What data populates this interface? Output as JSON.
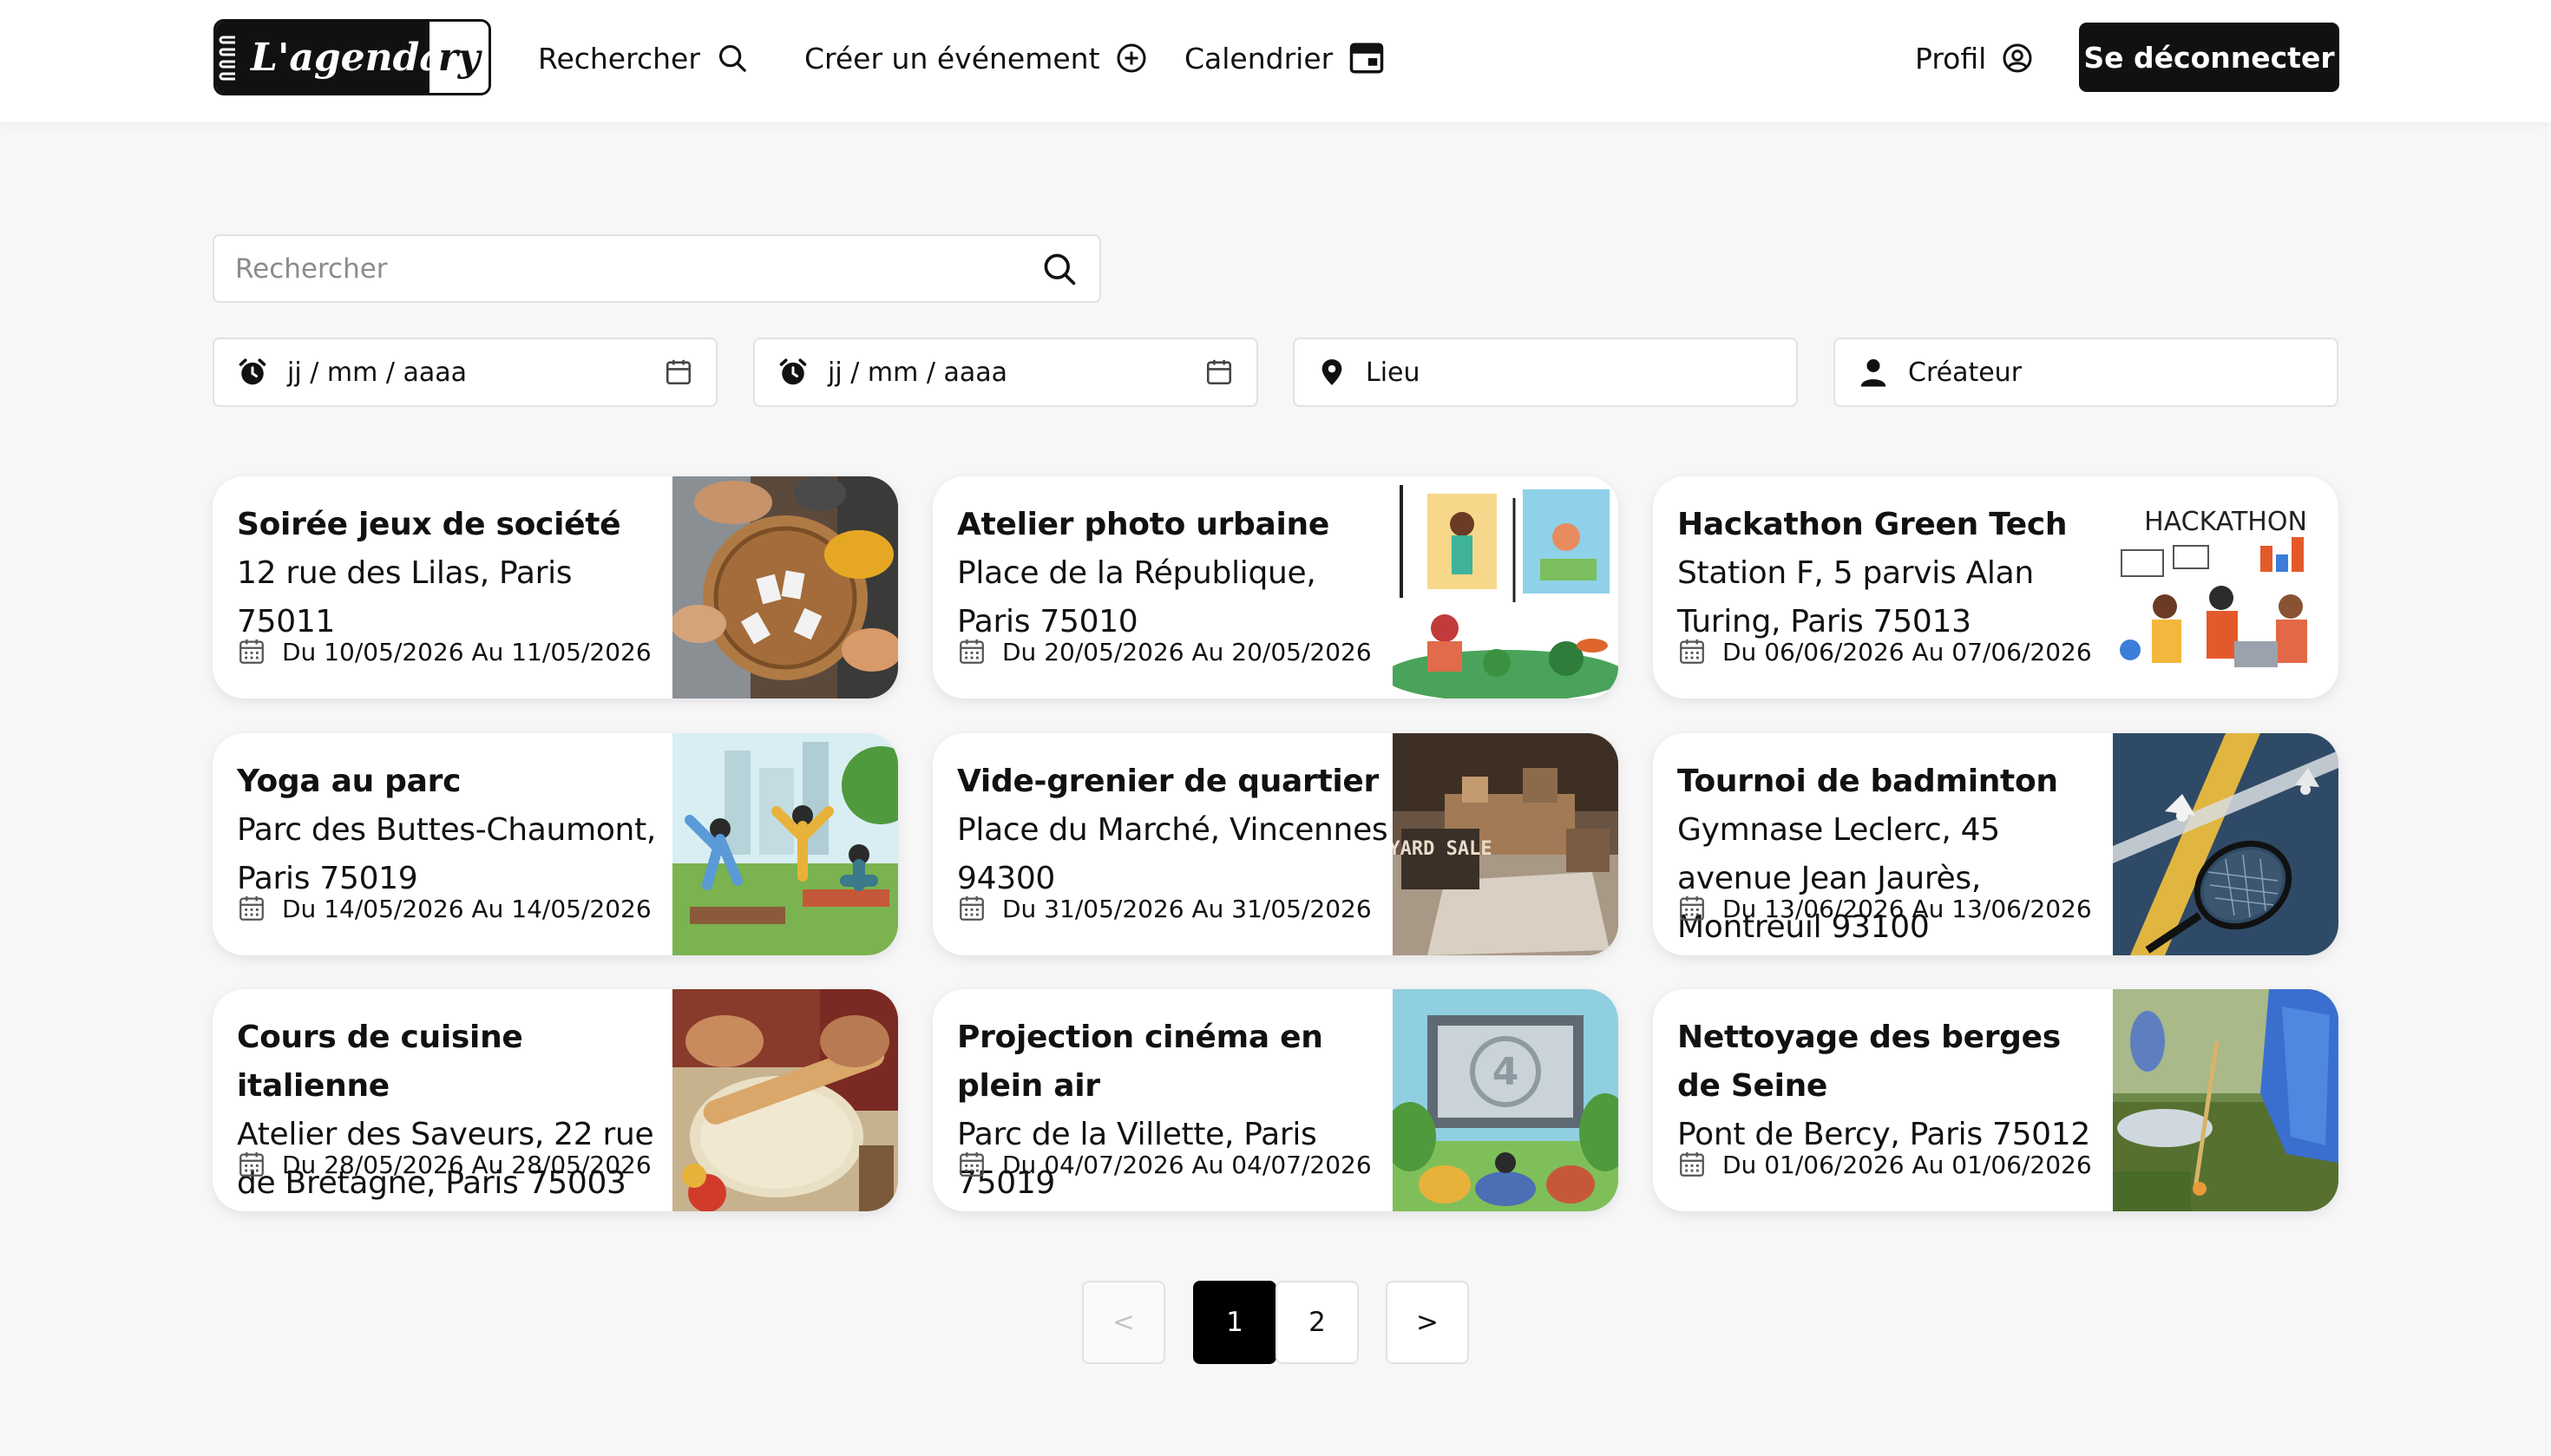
{
  "header": {
    "logo": {
      "left": "L'agenda",
      "right": "ry"
    },
    "nav": {
      "search": "Rechercher",
      "create_event": "Créer un événement",
      "calendar": "Calendrier",
      "profile": "Profil"
    },
    "logout_label": "Se déconnecter"
  },
  "search": {
    "placeholder": "Rechercher"
  },
  "filters": {
    "start_date_placeholder": "jj / mm / aaaa",
    "end_date_placeholder": "jj / mm / aaaa",
    "place_placeholder": "Lieu",
    "creator_placeholder": "Créateur"
  },
  "events": [
    {
      "title": "Soirée jeux de société",
      "address": "12 rue des Lilas, Paris 75011",
      "dates": "Du 10/05/2026 Au 11/05/2026",
      "image": "board-games-photo"
    },
    {
      "title": "Atelier photo urbaine",
      "address": "Place de la République, Paris 75010",
      "dates": "Du 20/05/2026 Au 20/05/2026",
      "image": "photo-workshop-illustration"
    },
    {
      "title": "Hackathon Green Tech",
      "address": "Station F, 5 parvis Alan Turing, Paris 75013",
      "dates": "Du 06/06/2026 Au 07/06/2026",
      "image": "hackathon-illustration",
      "image_caption": "HACKATHON"
    },
    {
      "title": "Yoga au parc",
      "address": "Parc des Buttes-Chaumont, Paris 75019",
      "dates": "Du 14/05/2026 Au 14/05/2026",
      "image": "yoga-illustration"
    },
    {
      "title": "Vide-grenier de quartier",
      "address": "Place du Marché, Vincennes 94300",
      "dates": "Du 31/05/2026 Au 31/05/2026",
      "image": "yard-sale-photo",
      "image_caption": "YARD SALE"
    },
    {
      "title": "Tournoi de badminton",
      "address": "Gymnase Leclerc, 45 avenue Jean Jaurès, Montreuil 93100",
      "dates": "Du 13/06/2026 Au 13/06/2026",
      "image": "badminton-photo"
    },
    {
      "title": "Cours de cuisine italienne",
      "address": "Atelier des Saveurs, 22 rue de Bretagne, Paris 75003",
      "dates": "Du 28/05/2026 Au 28/05/2026",
      "image": "pasta-cooking-photo"
    },
    {
      "title": "Projection cinéma en plein air",
      "address": "Parc de la Villette, Paris 75019",
      "dates": "Du 04/07/2026 Au 04/07/2026",
      "image": "open-air-cinema-illustration",
      "image_caption": "4"
    },
    {
      "title": "Nettoyage des berges de Seine",
      "address": "Pont de Bercy, Paris 75012",
      "dates": "Du 01/06/2026 Au 01/06/2026",
      "image": "cleanup-photo"
    }
  ],
  "pagination": {
    "prev": "<",
    "pages": [
      "1",
      "2"
    ],
    "next": ">",
    "current": "1"
  }
}
